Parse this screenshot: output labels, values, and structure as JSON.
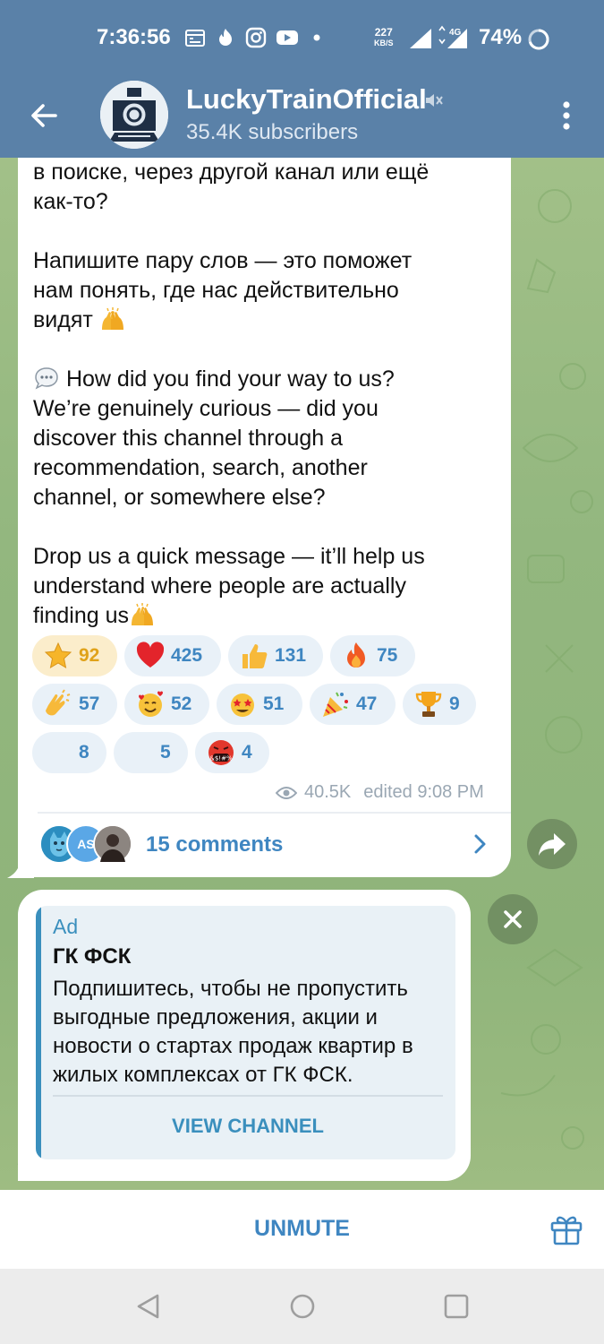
{
  "status_bar": {
    "time": "7:36:56",
    "net_speed": "227",
    "net_unit": "KB/S",
    "network_type": "4G",
    "battery": "74%"
  },
  "header": {
    "channel_name": "LuckyTrainOfficial",
    "subscribers": "35.4K subscribers"
  },
  "message": {
    "lines_ru_top": [
      "в поиске, через другой канал или ещё",
      "как-то?"
    ],
    "paragraph_ru": [
      "Напишите пару слов — это поможет",
      "нам понять, где нас действительно",
      "видят"
    ],
    "paragraph_en_1": [
      "How did you find your way to us?",
      "We’re genuinely curious — did you",
      "discover this channel through a",
      "recommendation, search, another",
      "channel, or somewhere else?"
    ],
    "paragraph_en_2": [
      "Drop us a quick message — it’ll help us",
      "understand where people are actually",
      "finding us"
    ],
    "reactions": [
      {
        "icon": "star-icon",
        "count": "92"
      },
      {
        "icon": "heart-icon",
        "count": "425"
      },
      {
        "icon": "thumbs-up-icon",
        "count": "131"
      },
      {
        "icon": "fire-icon",
        "count": "75"
      },
      {
        "icon": "clapping-hands-icon",
        "count": "57"
      },
      {
        "icon": "smiling-hearts-face-icon",
        "count": "52"
      },
      {
        "icon": "star-struck-face-icon",
        "count": "51"
      },
      {
        "icon": "party-popper-icon",
        "count": "47"
      },
      {
        "icon": "trophy-icon",
        "count": "9"
      },
      {
        "icon": "blank-reaction-icon",
        "count": "8"
      },
      {
        "icon": "blank-reaction-icon",
        "count": "5"
      },
      {
        "icon": "cursing-face-icon",
        "count": "4"
      }
    ],
    "views": "40.5K",
    "edited": "edited 9:08 PM",
    "comments_label": "15 comments",
    "comment_avatar_initials": "AS"
  },
  "ad": {
    "tag": "Ad",
    "title": "ГК ФСК",
    "body_lines": [
      "Подпишитесь, чтобы не пропустить",
      "выгодные предложения, акции и",
      "новости о стартах продаж квартир в",
      "жилых комплексах от ГК ФСК."
    ],
    "button": "VIEW CHANNEL"
  },
  "bottom": {
    "unmute": "UNMUTE"
  },
  "colors": {
    "header": "#5a81a8",
    "accent": "#3f86c1",
    "wallpaper": "#9cba86",
    "active_reaction_bg": "#fbedcb"
  }
}
